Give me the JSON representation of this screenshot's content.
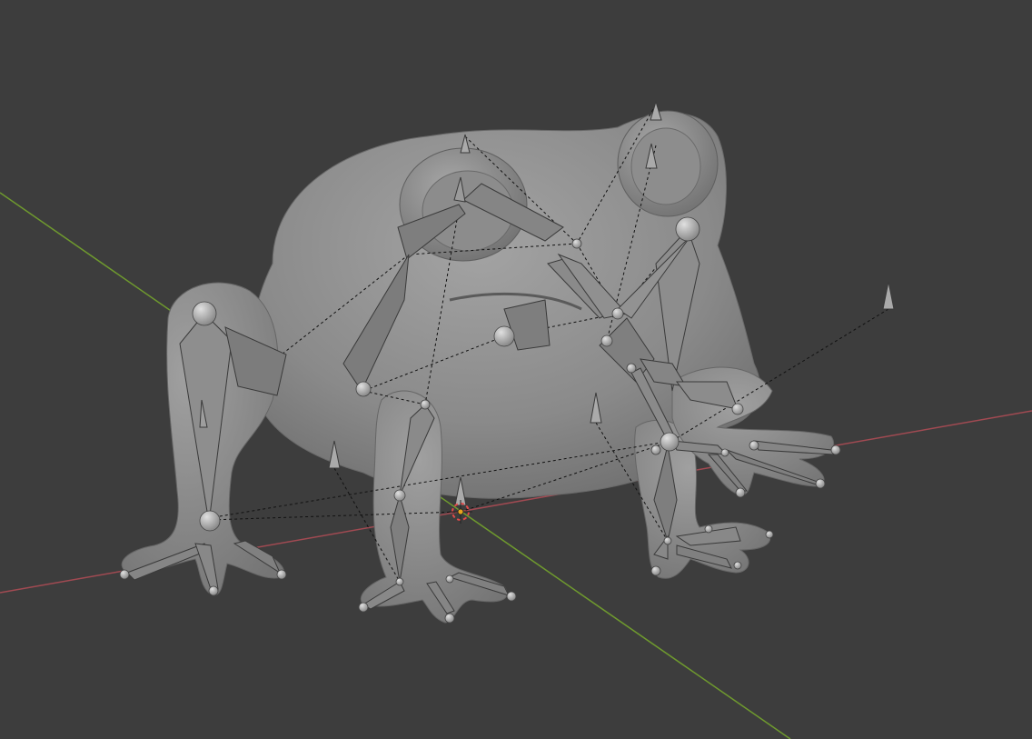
{
  "viewport": {
    "name": "3D Viewport",
    "mode": "Pose",
    "objects": [
      "frog-mesh",
      "armature"
    ]
  },
  "colors": {
    "background": "#3d3d3d",
    "x_axis": "#a14a52",
    "y_axis": "#6f9a2e",
    "mesh": "#8f8f8f",
    "bone": "#8a8a8a",
    "relationship_line": "#111111",
    "cursor_red": "#e24b4b",
    "origin": "#e8a21d"
  },
  "icons": [
    "3d-cursor-icon",
    "origin-point-icon"
  ]
}
